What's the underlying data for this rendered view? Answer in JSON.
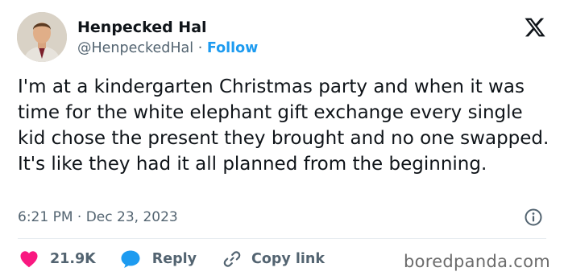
{
  "author": {
    "name": "Henpecked Hal",
    "handle": "@HenpeckedHal",
    "separator": "·",
    "follow_label": "Follow"
  },
  "tweet": {
    "text": "I'm at a kindergarten Christmas party and when it was time for the white elephant gift exchange every single kid chose the present they brought and no one swapped. It's like they had it all planned from the beginning.",
    "time": "6:21 PM",
    "separator": "·",
    "date": "Dec 23, 2023"
  },
  "actions": {
    "like_count": "21.9K",
    "reply_label": "Reply",
    "copy_link_label": "Copy link"
  },
  "watermark": "boredpanda.com",
  "icons": {
    "logo": "x-logo-icon",
    "info": "info-icon",
    "like": "heart-icon",
    "reply": "reply-bubble-icon",
    "copy": "link-icon"
  },
  "colors": {
    "accent": "#1d9bf0",
    "like": "#f91880",
    "text": "#0f1419",
    "muted": "#536471"
  }
}
